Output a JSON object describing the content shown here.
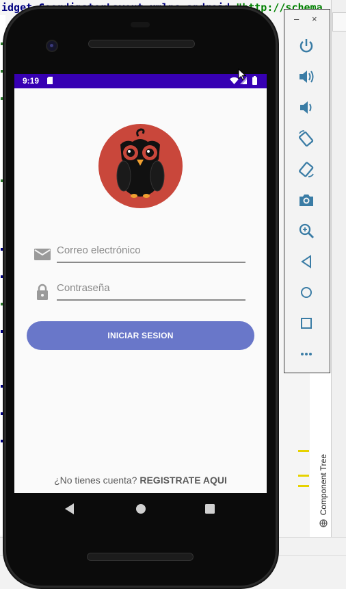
{
  "ide": {
    "code_line_prefix": "idget.CoordinatorLayout xmlns:android=",
    "code_line_string": "\"http://schemas.android.com/apk/res/android\"",
    "component_tree_tab": "Component Tree"
  },
  "emulator": {
    "window_controls": {
      "minimize": "–",
      "close": "×"
    },
    "toolbar_buttons": [
      "power-icon",
      "volume-up-icon",
      "volume-down-icon",
      "rotate-left-icon",
      "rotate-right-icon",
      "camera-icon",
      "zoom-icon",
      "back-icon",
      "home-icon",
      "overview-icon",
      "more-icon"
    ]
  },
  "device": {
    "status_bar": {
      "time": "9:19",
      "color": "#3700b3"
    },
    "logo": {
      "icon": "owl-logo",
      "background": "#c9473b"
    },
    "email_field": {
      "placeholder": "Correo electrónico",
      "icon": "mail-icon"
    },
    "password_field": {
      "placeholder": "Contraseña",
      "icon": "lock-icon"
    },
    "login_button": {
      "label": "INICIAR SESION",
      "color": "#6977c9"
    },
    "register": {
      "prompt": "¿No tienes cuenta?",
      "link": "REGISTRATE AQUI"
    }
  }
}
